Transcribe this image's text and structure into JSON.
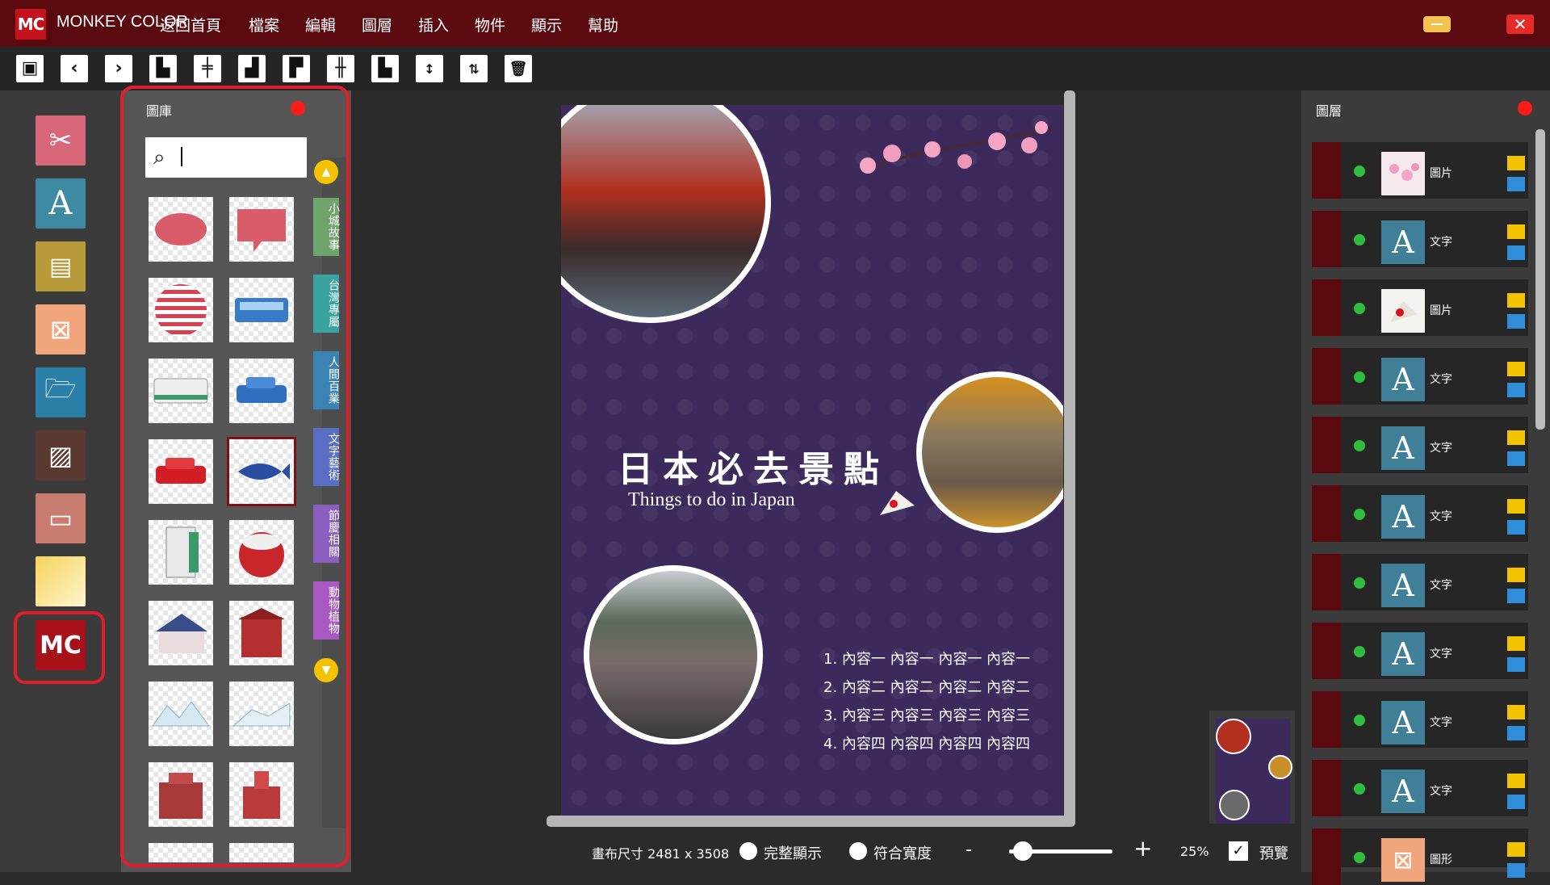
{
  "app": {
    "name": "MONKEY COLOR",
    "logo": "MC"
  },
  "menu": [
    "返回首頁",
    "檔案",
    "編輯",
    "圖層",
    "插入",
    "物件",
    "顯示",
    "幫助"
  ],
  "toolbar": [
    "save-icon",
    "undo-icon",
    "redo-icon",
    "align-left-icon",
    "align-center-icon",
    "align-right-icon",
    "align-top-icon",
    "align-middle-icon",
    "align-bottom-icon",
    "distribute-icon",
    "flip-icon",
    "delete-icon"
  ],
  "rail": [
    "crop-image-icon",
    "text-icon",
    "document-icon",
    "shapes-icon",
    "open-folder-icon",
    "image-icon",
    "template-icon",
    "gradient-icon",
    "mc-logo-icon"
  ],
  "gallery": {
    "title": "圖庫",
    "search_value": "",
    "categories": [
      "小城故事",
      "台灣專屬",
      "人間百業",
      "文字藝術",
      "節慶相關",
      "動物植物"
    ],
    "items": [
      "speech-bubble-cloud",
      "speech-bubble-box",
      "striped-circle",
      "blue-bus",
      "white-bus",
      "blue-car",
      "red-car",
      "blue-fish",
      "phone-booth",
      "rice-cooker",
      "house-blue-roof",
      "red-building",
      "snowy-landscape-1",
      "snowy-landscape-2",
      "red-fortress",
      "red-tower"
    ]
  },
  "poster": {
    "title": "日本必去景點",
    "subtitle": "Things to do in Japan",
    "list": [
      "1. 內容一 內容一 內容一 內容一",
      "2. 內容二 內容二 內容二 內容二",
      "3. 內容三 內容三 內容三 內容三",
      "4. 內容四 內容四 內容四 內容四"
    ],
    "background_color": "#3c2a5c"
  },
  "status": {
    "canvas_size": "畫布尺寸 2481 x 3508",
    "fit_all": "完整顯示",
    "fit_width": "符合寬度",
    "minus": "-",
    "plus": "+",
    "zoom": "25%",
    "preview": "預覽",
    "preview_checked": true,
    "zoom_fraction": 0.05
  },
  "layers": {
    "title": "圖層",
    "items": [
      {
        "name": "圖片",
        "thumb": "cherry-blossom-icon"
      },
      {
        "name": "文字",
        "thumb": "text-icon"
      },
      {
        "name": "圖片",
        "thumb": "fan-icon"
      },
      {
        "name": "文字",
        "thumb": "text-icon"
      },
      {
        "name": "文字",
        "thumb": "text-icon"
      },
      {
        "name": "文字",
        "thumb": "text-icon"
      },
      {
        "name": "文字",
        "thumb": "text-icon"
      },
      {
        "name": "文字",
        "thumb": "text-icon"
      },
      {
        "name": "文字",
        "thumb": "text-icon"
      },
      {
        "name": "文字",
        "thumb": "text-icon"
      },
      {
        "name": "圖形",
        "thumb": "shapes-icon"
      }
    ]
  },
  "colors": {
    "titlebar": "#5a0a0f",
    "accent_red": "#e21d2c",
    "brand": "#c4121d",
    "yellow": "#f5c200"
  }
}
